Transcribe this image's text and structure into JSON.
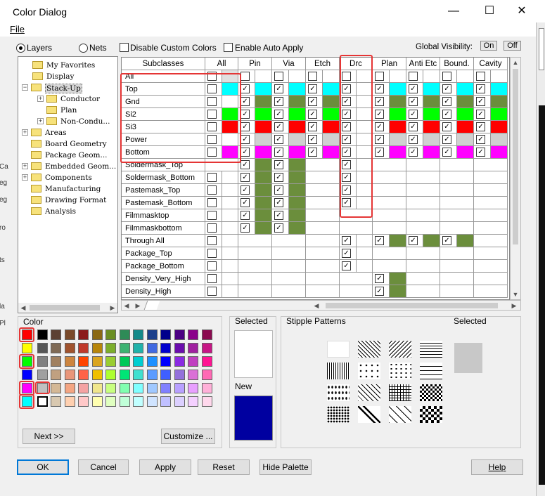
{
  "window": {
    "title": "Color Dialog",
    "minimize": "—",
    "maximize": "☐",
    "close": "✕"
  },
  "menu": {
    "file": "File"
  },
  "options": {
    "layers": "Layers",
    "nets": "Nets",
    "disable_custom_colors": "Disable Custom Colors",
    "enable_auto_apply": "Enable Auto Apply",
    "global_visibility": "Global Visibility:",
    "on": "On",
    "off": "Off"
  },
  "tree": {
    "items": [
      {
        "label": "My Favorites",
        "level": 1,
        "expander": "",
        "folder": true
      },
      {
        "label": "Display",
        "level": 1,
        "expander": "",
        "folder": true
      },
      {
        "label": "Stack-Up",
        "level": 0,
        "expander": "−",
        "folder": true,
        "open": true,
        "selected": true
      },
      {
        "label": "Conductor",
        "level": 1,
        "expander": "+",
        "folder": true
      },
      {
        "label": "Plan",
        "level": 1,
        "expander": "",
        "folder": true
      },
      {
        "label": "Non-Condu...",
        "level": 1,
        "expander": "+",
        "folder": true
      },
      {
        "label": "Areas",
        "level": 0,
        "expander": "+",
        "folder": true
      },
      {
        "label": "Board Geometry",
        "level": 0,
        "expander": "",
        "folder": true
      },
      {
        "label": "Package Geom...",
        "level": 0,
        "expander": "",
        "folder": true
      },
      {
        "label": "Embedded Geom...",
        "level": 0,
        "expander": "+",
        "folder": true
      },
      {
        "label": "Components",
        "level": 0,
        "expander": "+",
        "folder": true
      },
      {
        "label": "Manufacturing",
        "level": 0,
        "expander": "",
        "folder": true
      },
      {
        "label": "Drawing Format",
        "level": 0,
        "expander": "",
        "folder": true
      },
      {
        "label": "Analysis",
        "level": 0,
        "expander": "",
        "folder": true
      }
    ]
  },
  "grid": {
    "subclasses_header": "Subclasses",
    "columns": [
      "All",
      "Pin",
      "Via",
      "Etch",
      "Drc",
      "Plan",
      "Anti Etc",
      "Bound.",
      "Cavity"
    ],
    "rows": [
      {
        "name": "All",
        "cells": [
          "u:#e0e0e0",
          "u:",
          "u:",
          "u:",
          "u:",
          "u:",
          "u:",
          "u:",
          "u:"
        ]
      },
      {
        "name": "Top",
        "cells": [
          "u:#00ffff",
          "c:#00ffff",
          "c:#00ffff",
          "c:#00ffff",
          "c:",
          "c:#00ffff",
          "c:#00ffff",
          "c:#00ffff",
          "c:#00ffff"
        ]
      },
      {
        "name": "Gnd",
        "cells": [
          "u:",
          "c:#6b8e3c",
          "c:#6b8e3c",
          "c:#6b8e3c",
          "c:",
          "c:#6b8e3c",
          "c:#6b8e3c",
          "c:#6b8e3c",
          "c:#6b8e3c"
        ]
      },
      {
        "name": "Si2",
        "cells": [
          "u:#00ff00",
          "c:#00ff00",
          "c:#00ff00",
          "c:#00ff00",
          "c:",
          "c:#00ff00",
          "c:#00ff00",
          "c:#00ff00",
          "c:#00ff00"
        ]
      },
      {
        "name": "Si3",
        "cells": [
          "u:#ff0000",
          "c:#ff0000",
          "c:#ff0000",
          "c:#ff0000",
          "c:",
          "c:#ff0000",
          "c:#ff0000",
          "c:#ff0000",
          "c:#ff0000"
        ]
      },
      {
        "name": "Power",
        "cells": [
          "u:",
          "c:#d0d0d0",
          "c:#d0d0d0",
          "c:#d0d0d0",
          "c:",
          "c:#d0d0d0",
          "c:#d0d0d0",
          "c:#d0d0d0",
          "c:#d0d0d0"
        ]
      },
      {
        "name": "Bottom",
        "cells": [
          "u:#ff00ff",
          "c:#ff00ff",
          "c:#ff00ff",
          "c:#ff00ff",
          "c:",
          "c:#ff00ff",
          "c:#ff00ff",
          "c:#ff00ff",
          "c:#ff00ff"
        ]
      },
      {
        "name": "Soldermask_Top",
        "cells": [
          "",
          "c:#6b8e3c",
          "c:#6b8e3c",
          "",
          "c:",
          "",
          "",
          "",
          ""
        ]
      },
      {
        "name": "Soldermask_Bottom",
        "cells": [
          "u:",
          "c:#6b8e3c",
          "c:#6b8e3c",
          "",
          "c:",
          "",
          "",
          "",
          ""
        ]
      },
      {
        "name": "Pastemask_Top",
        "cells": [
          "u:",
          "c:#6b8e3c",
          "c:#6b8e3c",
          "",
          "c:",
          "",
          "",
          "",
          ""
        ]
      },
      {
        "name": "Pastemask_Bottom",
        "cells": [
          "u:",
          "c:#6b8e3c",
          "c:#6b8e3c",
          "",
          "c:",
          "",
          "",
          "",
          ""
        ]
      },
      {
        "name": "Filmmasktop",
        "cells": [
          "u:",
          "c:#6b8e3c",
          "c:#6b8e3c",
          "",
          "",
          "",
          "",
          "",
          ""
        ]
      },
      {
        "name": "Filmmaskbottom",
        "cells": [
          "u:",
          "c:#6b8e3c",
          "c:#6b8e3c",
          "",
          "",
          "",
          "",
          "",
          ""
        ]
      },
      {
        "name": "Through All",
        "cells": [
          "u:",
          "",
          "",
          "",
          "c:",
          "c:#6b8e3c",
          "c:#6b8e3c",
          "c:#6b8e3c",
          ""
        ]
      },
      {
        "name": "Package_Top",
        "cells": [
          "u:",
          "",
          "",
          "",
          "c:",
          "",
          "",
          "",
          ""
        ]
      },
      {
        "name": "Package_Bottom",
        "cells": [
          "u:",
          "",
          "",
          "",
          "c:",
          "",
          "",
          "",
          ""
        ]
      },
      {
        "name": "Density_Very_High",
        "cells": [
          "u:",
          "",
          "",
          "",
          "",
          "c:#6b8e3c",
          "",
          "",
          ""
        ]
      },
      {
        "name": "Density_High",
        "cells": [
          "u:",
          "",
          "",
          "",
          "",
          "c:#6b8e3c",
          "",
          "",
          ""
        ]
      }
    ]
  },
  "palette": {
    "label": "Color",
    "rows": [
      [
        "#ff0000",
        "#000000",
        "#5c4033",
        "#7a4a2a",
        "#8b1a1a",
        "#8b6914",
        "#6b8e23",
        "#2e8b57",
        "#138a8a",
        "#1b3f8b",
        "#00008b",
        "#4b0082",
        "#8b008b",
        "#8b0a50"
      ],
      [
        "#ffff00",
        "#555555",
        "#7f6a55",
        "#a0522d",
        "#c0392b",
        "#b8860b",
        "#7cae2c",
        "#3cb371",
        "#20b2aa",
        "#4169e1",
        "#0000cd",
        "#6a0dad",
        "#a020a0",
        "#c71585"
      ],
      [
        "#00ff00",
        "#808080",
        "#a08060",
        "#cd853f",
        "#ff4500",
        "#daa520",
        "#9acd32",
        "#00c957",
        "#00ced1",
        "#1e90ff",
        "#0000ff",
        "#8a2be2",
        "#c040c0",
        "#ff1493"
      ],
      [
        "#0000ff",
        "#a0a0a0",
        "#c0a080",
        "#e9967a",
        "#ff6347",
        "#f0c000",
        "#adff2f",
        "#00e676",
        "#40e0d0",
        "#5b9bff",
        "#3f5fff",
        "#9370db",
        "#da70d6",
        "#ff69b4"
      ],
      [
        "#ff00ff",
        "#c0c0c0",
        "#d4b896",
        "#f4a582",
        "#f4a3a3",
        "#f0e68c",
        "#c8ff80",
        "#80ffb0",
        "#80ffff",
        "#a0c8ff",
        "#8080ff",
        "#b8a0ff",
        "#e8a0ff",
        "#ffb0d8"
      ],
      [
        "#00ffff",
        "#ffffff",
        "#d8c8b0",
        "#ffd0b0",
        "#ffc8c8",
        "#ffffb0",
        "#e0ffc0",
        "#c0ffd8",
        "#c0ffff",
        "#d0e4ff",
        "#c0c0ff",
        "#dcd0ff",
        "#f4d0ff",
        "#ffd8ec"
      ]
    ],
    "next_button": "Next >>",
    "customize_button": "Customize ..."
  },
  "selected_panel": {
    "selected_label": "Selected",
    "new_label": "New",
    "selected_color": "#ffffff",
    "new_color": "#0000a0"
  },
  "stipple": {
    "label": "Stipple Patterns",
    "selected_label": "Selected",
    "selected_color": "#c8c8c8"
  },
  "buttons": {
    "ok": "OK",
    "cancel": "Cancel",
    "apply": "Apply",
    "reset": "Reset",
    "hide_palette": "Hide Palette",
    "help": "Help"
  },
  "left_edge_fragments": [
    "Ca",
    "eg",
    "eg",
    "ro",
    "ts",
    "la",
    "Pl"
  ]
}
